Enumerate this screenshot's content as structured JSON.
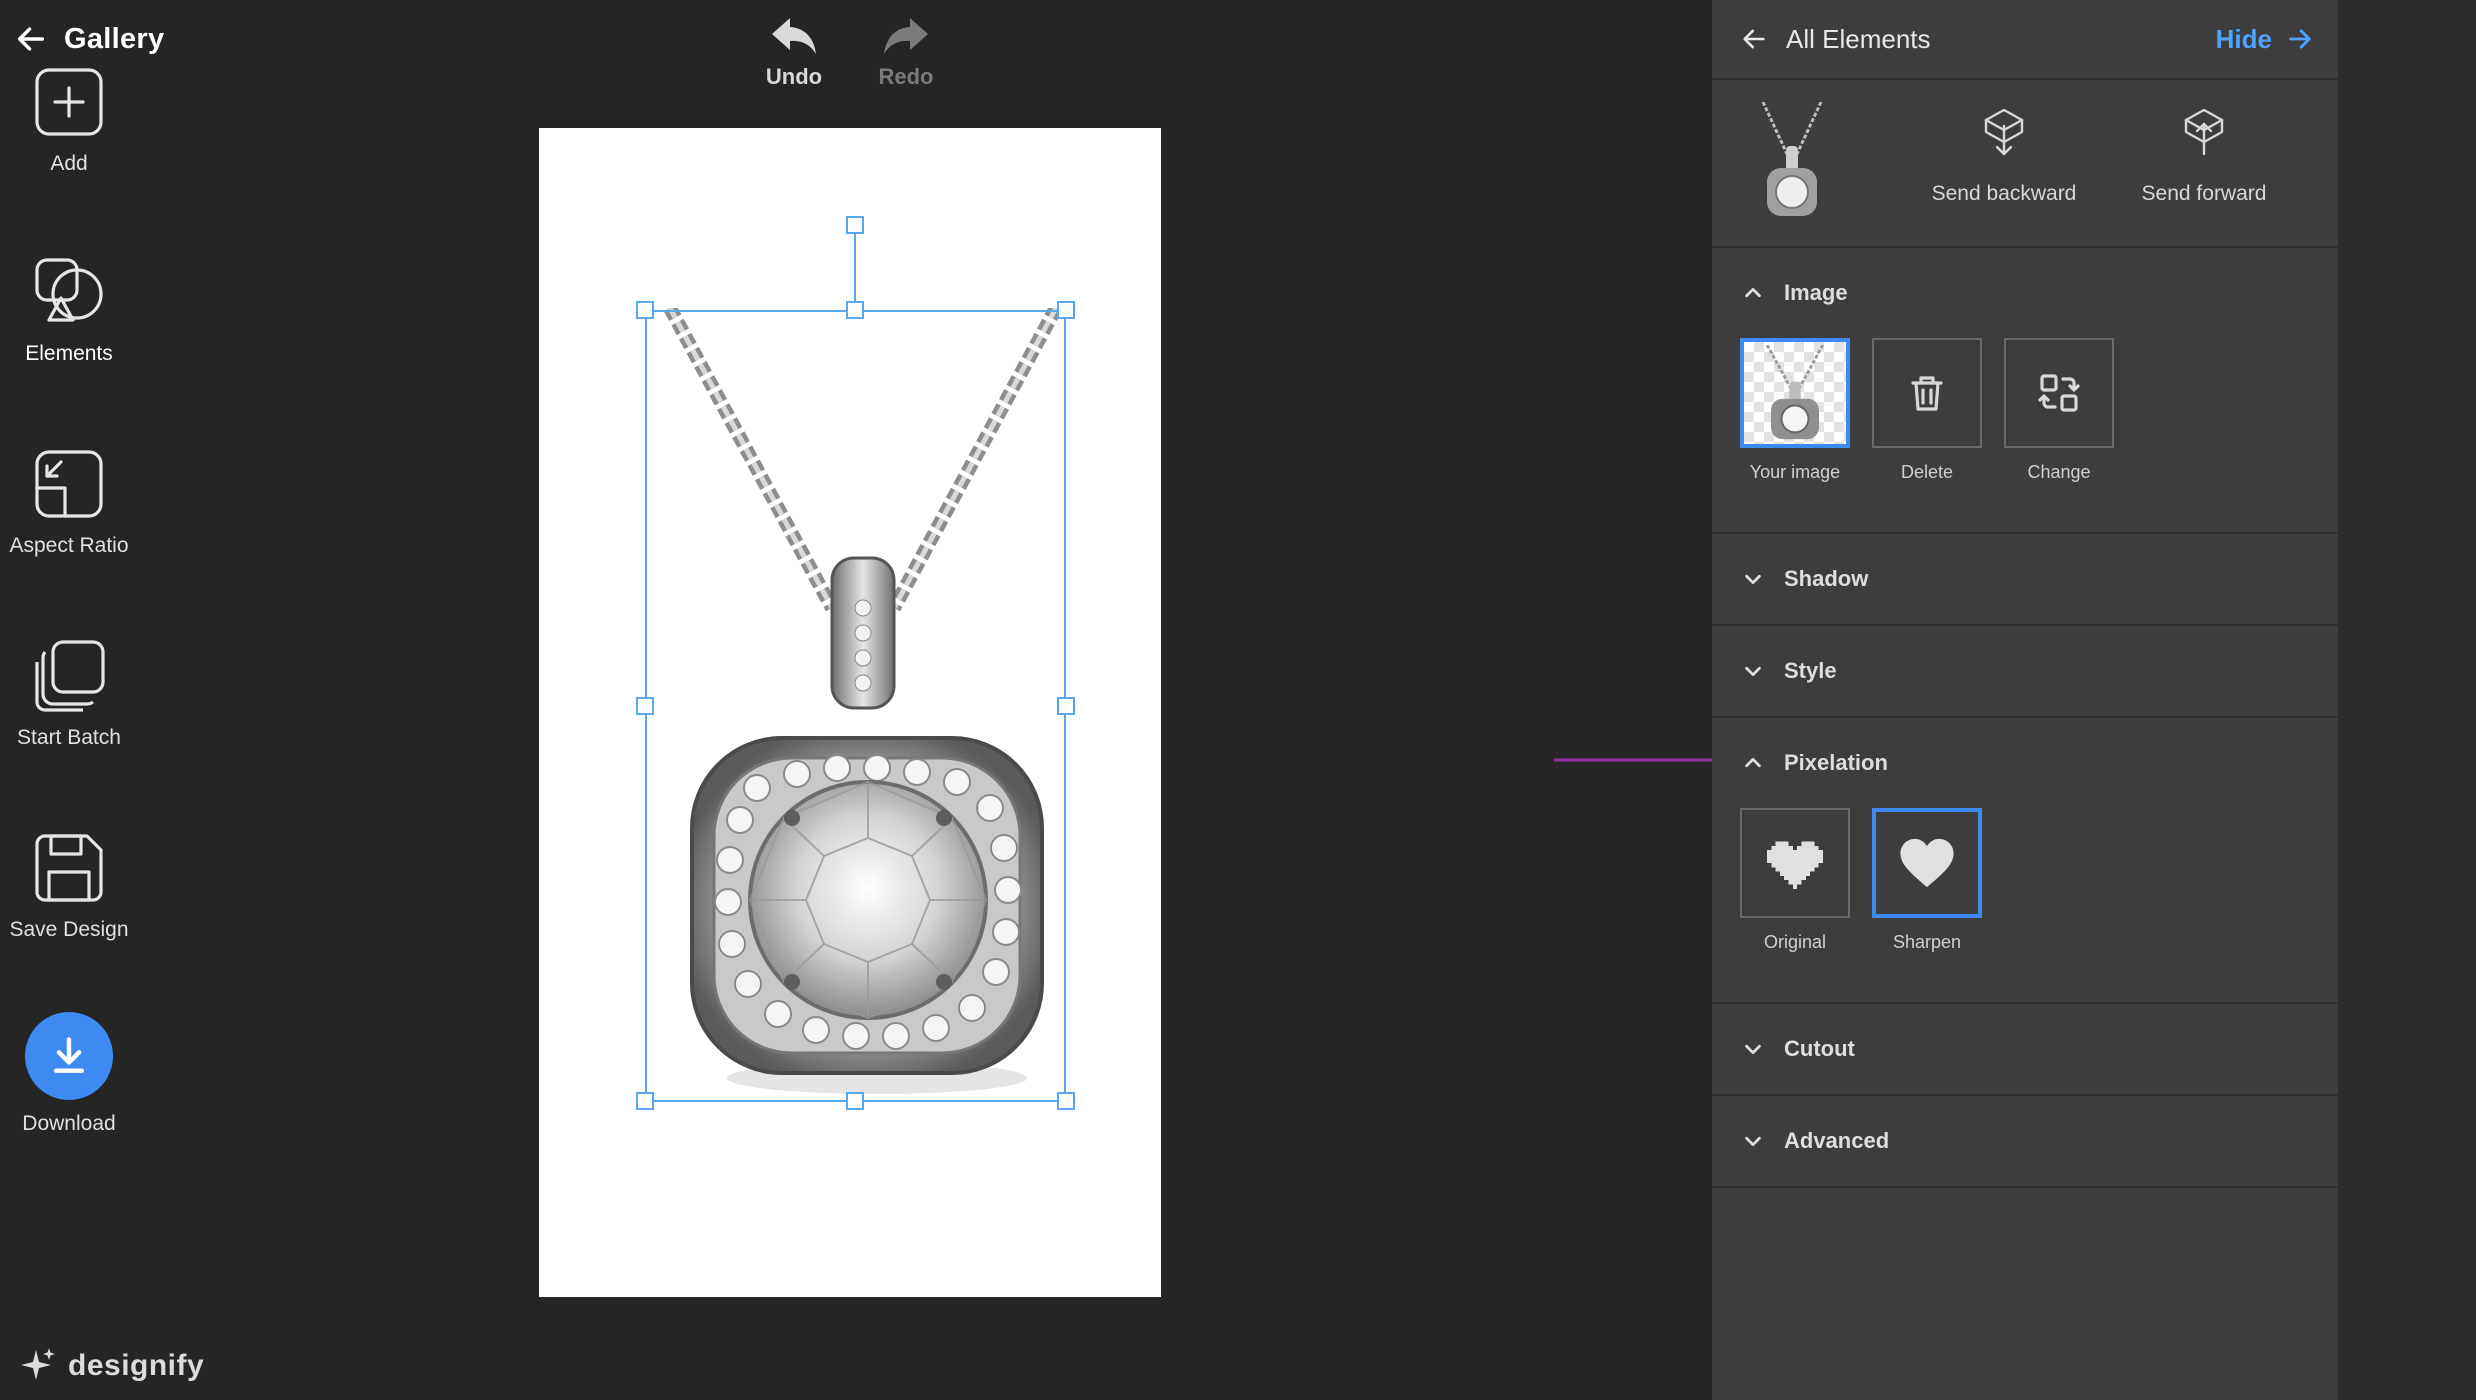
{
  "topbar": {
    "back_label": "Gallery",
    "undo_label": "Undo",
    "redo_label": "Redo"
  },
  "brand": {
    "name": "designify"
  },
  "panel": {
    "header": {
      "back_label": "All Elements",
      "hide_label": "Hide"
    },
    "element": {
      "send_backward_label": "Send backward",
      "send_forward_label": "Send forward"
    },
    "sections": {
      "image": {
        "title": "Image",
        "expanded": true,
        "tiles": [
          {
            "label": "Your image",
            "icon": "image-thumbnail",
            "selected": true
          },
          {
            "label": "Delete",
            "icon": "trash-icon",
            "selected": false
          },
          {
            "label": "Change",
            "icon": "swap-icon",
            "selected": false
          }
        ]
      },
      "shadow": {
        "title": "Shadow",
        "expanded": false
      },
      "style": {
        "title": "Style",
        "expanded": false
      },
      "pixelation": {
        "title": "Pixelation",
        "expanded": true,
        "tiles": [
          {
            "label": "Original",
            "icon": "pixel-heart-icon",
            "selected": false
          },
          {
            "label": "Sharpen",
            "icon": "heart-icon",
            "selected": true
          }
        ]
      },
      "cutout": {
        "title": "Cutout",
        "expanded": false
      },
      "advanced": {
        "title": "Advanced",
        "expanded": false
      }
    }
  },
  "rail": {
    "items": [
      {
        "label": "Add",
        "icon": "plus-square-icon"
      },
      {
        "label": "Elements",
        "icon": "shapes-icon",
        "active": true
      },
      {
        "label": "Aspect Ratio",
        "icon": "aspect-ratio-icon"
      },
      {
        "label": "Start Batch",
        "icon": "stack-icon"
      },
      {
        "label": "Save Design",
        "icon": "floppy-icon"
      },
      {
        "label": "Download",
        "icon": "download-icon"
      }
    ]
  },
  "colors": {
    "background": "#252525",
    "panel": "#3d3d3d",
    "rail": "#2b2b2b",
    "accent": "#3d8bf2",
    "link": "#4da3ff",
    "selection": "#58a8f0",
    "annotation_arrow": "#8e2fa0"
  }
}
